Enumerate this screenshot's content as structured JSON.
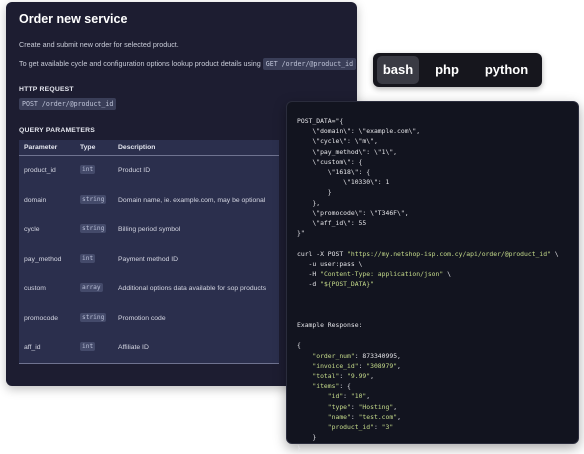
{
  "api_doc": {
    "title": "Order new service",
    "description": "Create and submit new order for selected product.",
    "lookup_text": "To get available cycle and configuration options lookup product details using",
    "lookup_endpoint": "GET /order/@product_id",
    "http_request_label": "HTTP REQUEST",
    "http_request": "POST /order/@product_id",
    "query_params_label": "QUERY PARAMETERS",
    "columns": [
      "Parameter",
      "Type",
      "Description"
    ],
    "params": [
      {
        "name": "product_id",
        "type": "int",
        "description": "Product ID"
      },
      {
        "name": "domain",
        "type": "string",
        "description": "Domain name, ie. example.com, may be optional"
      },
      {
        "name": "cycle",
        "type": "string",
        "description": "Billing period symbol"
      },
      {
        "name": "pay_method",
        "type": "int",
        "description": "Payment method ID"
      },
      {
        "name": "custom",
        "type": "array",
        "description": "Additional options data available for sop products"
      },
      {
        "name": "promocode",
        "type": "string",
        "description": "Promotion code"
      },
      {
        "name": "aff_id",
        "type": "int",
        "description": "Affiliate ID"
      }
    ]
  },
  "lang_tabs": {
    "items": [
      "bash",
      "php",
      "python"
    ],
    "active": "bash"
  },
  "code": {
    "lines": [
      [
        [
          "POST_DATA=\"{",
          ""
        ]
      ],
      [
        [
          "    \\\"domain\\\": \\\"example.com\\\",",
          ""
        ]
      ],
      [
        [
          "    \\\"cycle\\\": \\\"m\\\",",
          ""
        ]
      ],
      [
        [
          "    \\\"pay_method\\\": \\\"1\\\",",
          ""
        ]
      ],
      [
        [
          "    \\\"custom\\\": {",
          ""
        ]
      ],
      [
        [
          "        \\\"1618\\\": {",
          ""
        ]
      ],
      [
        [
          "            \\\"10330\\\": 1",
          ""
        ]
      ],
      [
        [
          "        }",
          ""
        ]
      ],
      [
        [
          "    },",
          ""
        ]
      ],
      [
        [
          "    \\\"promocode\\\": \\\"T346F\\\",",
          ""
        ]
      ],
      [
        [
          "    \\\"aff_id\\\": 55",
          ""
        ]
      ],
      [
        [
          "}\"",
          ""
        ]
      ],
      [
        [
          "",
          ""
        ]
      ],
      [
        [
          "curl -X POST ",
          ""
        ],
        [
          "\"https://my.netshop-isp.com.cy/api/order/@product_id\"",
          "str"
        ],
        [
          " \\",
          ""
        ]
      ],
      [
        [
          "   -u user:pass \\",
          ""
        ]
      ],
      [
        [
          "   -H ",
          ""
        ],
        [
          "\"Content-Type: application/json\"",
          "str"
        ],
        [
          " \\",
          ""
        ]
      ],
      [
        [
          "   -d ",
          ""
        ],
        [
          "\"${POST_DATA}\"",
          "str"
        ]
      ],
      [
        [
          "",
          ""
        ]
      ],
      [
        [
          "",
          ""
        ]
      ],
      [
        [
          "",
          ""
        ]
      ],
      [
        [
          "Example Response:",
          ""
        ]
      ],
      [
        [
          "",
          ""
        ]
      ],
      [
        [
          "{",
          ""
        ]
      ],
      [
        [
          "    ",
          ""
        ],
        [
          "\"order_num\"",
          "str"
        ],
        [
          ": 873340995,",
          ""
        ]
      ],
      [
        [
          "    ",
          ""
        ],
        [
          "\"invoice_id\"",
          "str"
        ],
        [
          ": ",
          ""
        ],
        [
          "\"308979\"",
          "str"
        ],
        [
          ",",
          ""
        ]
      ],
      [
        [
          "    ",
          ""
        ],
        [
          "\"total\"",
          "str"
        ],
        [
          ": ",
          ""
        ],
        [
          "\"9.99\"",
          "str"
        ],
        [
          ",",
          ""
        ]
      ],
      [
        [
          "    ",
          ""
        ],
        [
          "\"items\"",
          "str"
        ],
        [
          ": {",
          ""
        ]
      ],
      [
        [
          "        ",
          ""
        ],
        [
          "\"id\"",
          "str"
        ],
        [
          ": ",
          ""
        ],
        [
          "\"10\"",
          "str"
        ],
        [
          ",",
          ""
        ]
      ],
      [
        [
          "        ",
          ""
        ],
        [
          "\"type\"",
          "str"
        ],
        [
          ": ",
          ""
        ],
        [
          "\"Hosting\"",
          "str"
        ],
        [
          ",",
          ""
        ]
      ],
      [
        [
          "        ",
          ""
        ],
        [
          "\"name\"",
          "str"
        ],
        [
          ": ",
          ""
        ],
        [
          "\"test.com\"",
          "str"
        ],
        [
          ",",
          ""
        ]
      ],
      [
        [
          "        ",
          ""
        ],
        [
          "\"product_id\"",
          "str"
        ],
        [
          ": ",
          ""
        ],
        [
          "\"3\"",
          "str"
        ]
      ],
      [
        [
          "    }",
          ""
        ]
      ],
      [
        [
          "}",
          ""
        ]
      ]
    ]
  }
}
